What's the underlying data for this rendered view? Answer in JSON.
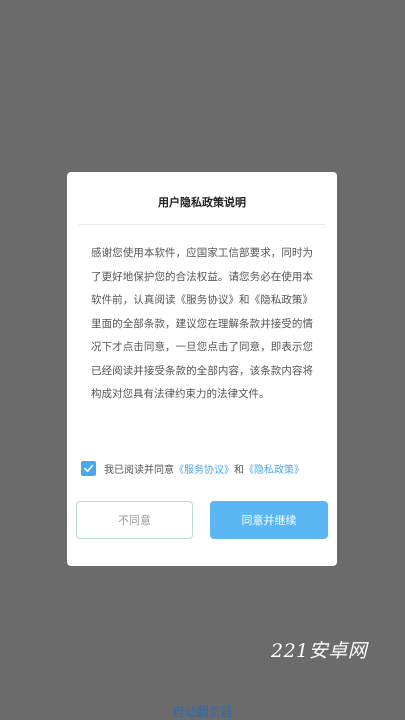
{
  "dialog": {
    "title": "用户隐私政策说明",
    "body": "感谢您使用本软件，应国家工信部要求，同时为了更好地保护您的合法权益。请您务必在使用本软件前，认真阅读《服务协议》和《隐私政策》里面的全部条款，建议您在理解条款并接受的情况下才点击同意，一旦您点击了同意，即表示您已经阅读并接受条款的全部内容，该条款内容将构成对您具有法律约束力的法律文件。",
    "agree": {
      "checked": true,
      "prefix": "我已阅读并同意",
      "service_link": "《服务协议》",
      "conjunction": "和",
      "privacy_link": "《隐私政策》"
    },
    "decline_label": "不同意",
    "accept_label": "同意并继续"
  },
  "watermark": "221安卓网",
  "bottom_link": "自动翻页器",
  "colors": {
    "overlay": "#6b6b6b",
    "accent": "#4aa7ec",
    "accept_button": "#5bb7f4"
  }
}
